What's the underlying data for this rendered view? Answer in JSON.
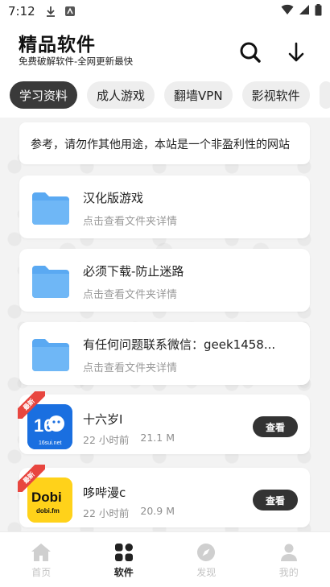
{
  "status_bar": {
    "time": "7:12"
  },
  "header": {
    "title": "精品软件",
    "subtitle": "免费破解软件-全网更新最快"
  },
  "tabs": [
    {
      "label": "学习资料",
      "active": true
    },
    {
      "label": "成人游戏",
      "active": false
    },
    {
      "label": "翻墙VPN",
      "active": false
    },
    {
      "label": "影视软件",
      "active": false
    }
  ],
  "notice": {
    "text": "参考，请勿作其他用途，本站是一个非盈利性的网站"
  },
  "folders": [
    {
      "title": "汉化版游戏",
      "subtitle": "点击查看文件夹详情"
    },
    {
      "title": "必须下载-防止迷路",
      "subtitle": "点击查看文件夹详情"
    },
    {
      "title": "有任何问题联系微信：geek1458...",
      "subtitle": "点击查看文件夹详情"
    }
  ],
  "apps": [
    {
      "name": "十六岁I",
      "time": "22 小时前",
      "size": "21.1 M",
      "badge": "最新",
      "button": "查看",
      "icon_line1": "16",
      "icon_line2": "16sui.net",
      "icon_bg": "#1a6fe0"
    },
    {
      "name": "哆哔漫c",
      "time": "22 小时前",
      "size": "20.9 M",
      "badge": "最新",
      "button": "查看",
      "icon_line1": "Dobi",
      "icon_line2": "dobi.fm",
      "icon_bg": "#ffd21a"
    }
  ],
  "bottom_nav": [
    {
      "label": "首页",
      "icon": "home-icon",
      "active": false
    },
    {
      "label": "软件",
      "icon": "apps-grid-icon",
      "active": true
    },
    {
      "label": "发现",
      "icon": "compass-icon",
      "active": false
    },
    {
      "label": "我的",
      "icon": "person-icon",
      "active": false
    }
  ],
  "colors": {
    "accent": "#3a3a3a",
    "folder_blue": "#5aa9f2",
    "badge_red": "#e8463f",
    "inactive_nav": "#c4c4c4"
  }
}
